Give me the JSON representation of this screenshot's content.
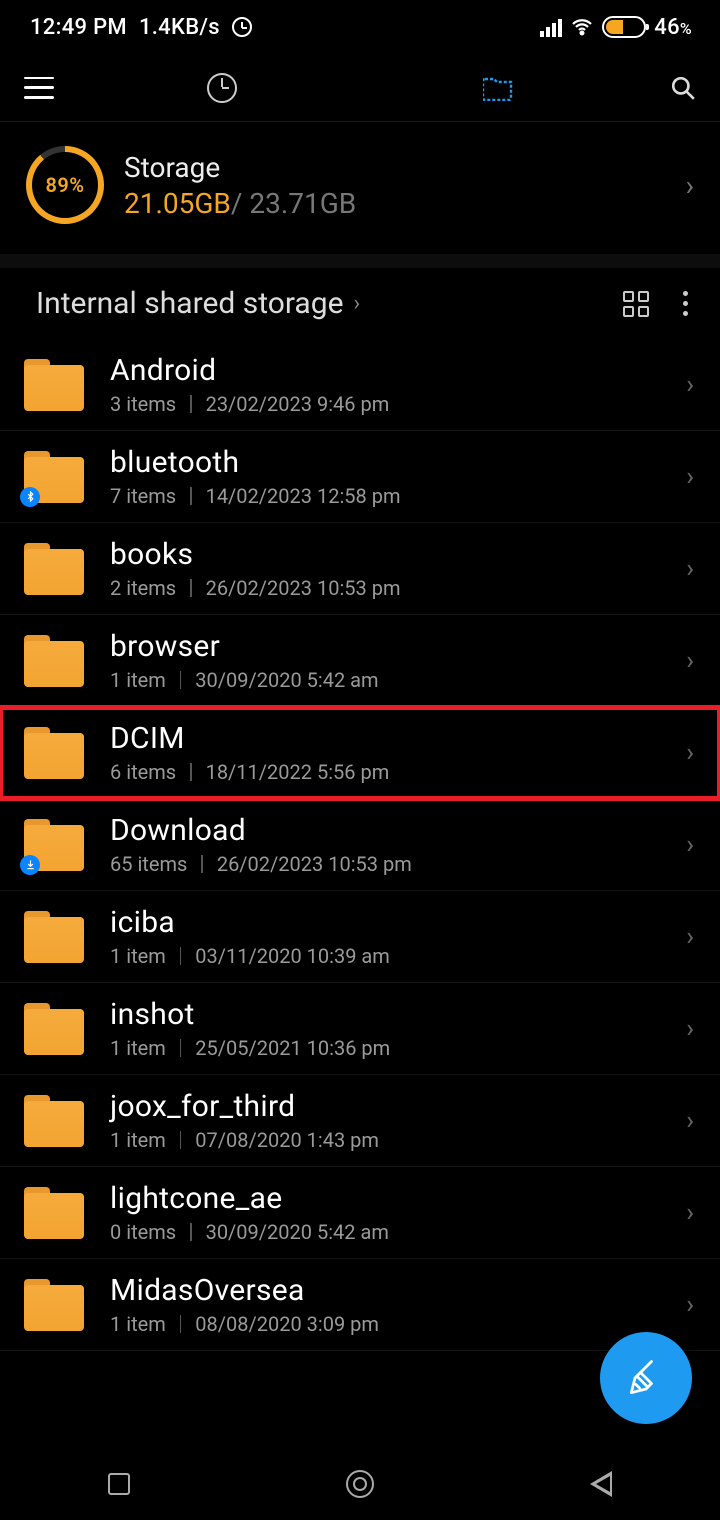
{
  "status": {
    "time": "12:49 PM",
    "net_speed": "1.4KB/s",
    "battery_pct": "46",
    "battery_sym": "%"
  },
  "storage": {
    "label": "Storage",
    "percent": "89%",
    "used": "21.05GB",
    "sep": "/ ",
    "total": "23.71GB"
  },
  "breadcrumb": {
    "path": "Internal shared storage"
  },
  "folders": [
    {
      "name": "Android",
      "count": "3 items",
      "date": "23/02/2023 9:46 pm",
      "badge": "",
      "hl": false
    },
    {
      "name": "bluetooth",
      "count": "7 items",
      "date": "14/02/2023 12:58 pm",
      "badge": "bt",
      "hl": false
    },
    {
      "name": "books",
      "count": "2 items",
      "date": "26/02/2023 10:53 pm",
      "badge": "",
      "hl": false
    },
    {
      "name": "browser",
      "count": "1 item",
      "date": "30/09/2020 5:42 am",
      "badge": "",
      "hl": false
    },
    {
      "name": "DCIM",
      "count": "6 items",
      "date": "18/11/2022 5:56 pm",
      "badge": "",
      "hl": true
    },
    {
      "name": "Download",
      "count": "65 items",
      "date": "26/02/2023 10:53 pm",
      "badge": "dl",
      "hl": false
    },
    {
      "name": "iciba",
      "count": "1 item",
      "date": "03/11/2020 10:39 am",
      "badge": "",
      "hl": false
    },
    {
      "name": "inshot",
      "count": "1 item",
      "date": "25/05/2021 10:36 pm",
      "badge": "",
      "hl": false
    },
    {
      "name": "joox_for_third",
      "count": "1 item",
      "date": "07/08/2020 1:43 pm",
      "badge": "",
      "hl": false
    },
    {
      "name": "lightcone_ae",
      "count": "0 items",
      "date": "30/09/2020 5:42 am",
      "badge": "",
      "hl": false
    },
    {
      "name": "MidasOversea",
      "count": "1 item",
      "date": "08/08/2020 3:09 pm",
      "badge": "",
      "hl": false
    }
  ]
}
